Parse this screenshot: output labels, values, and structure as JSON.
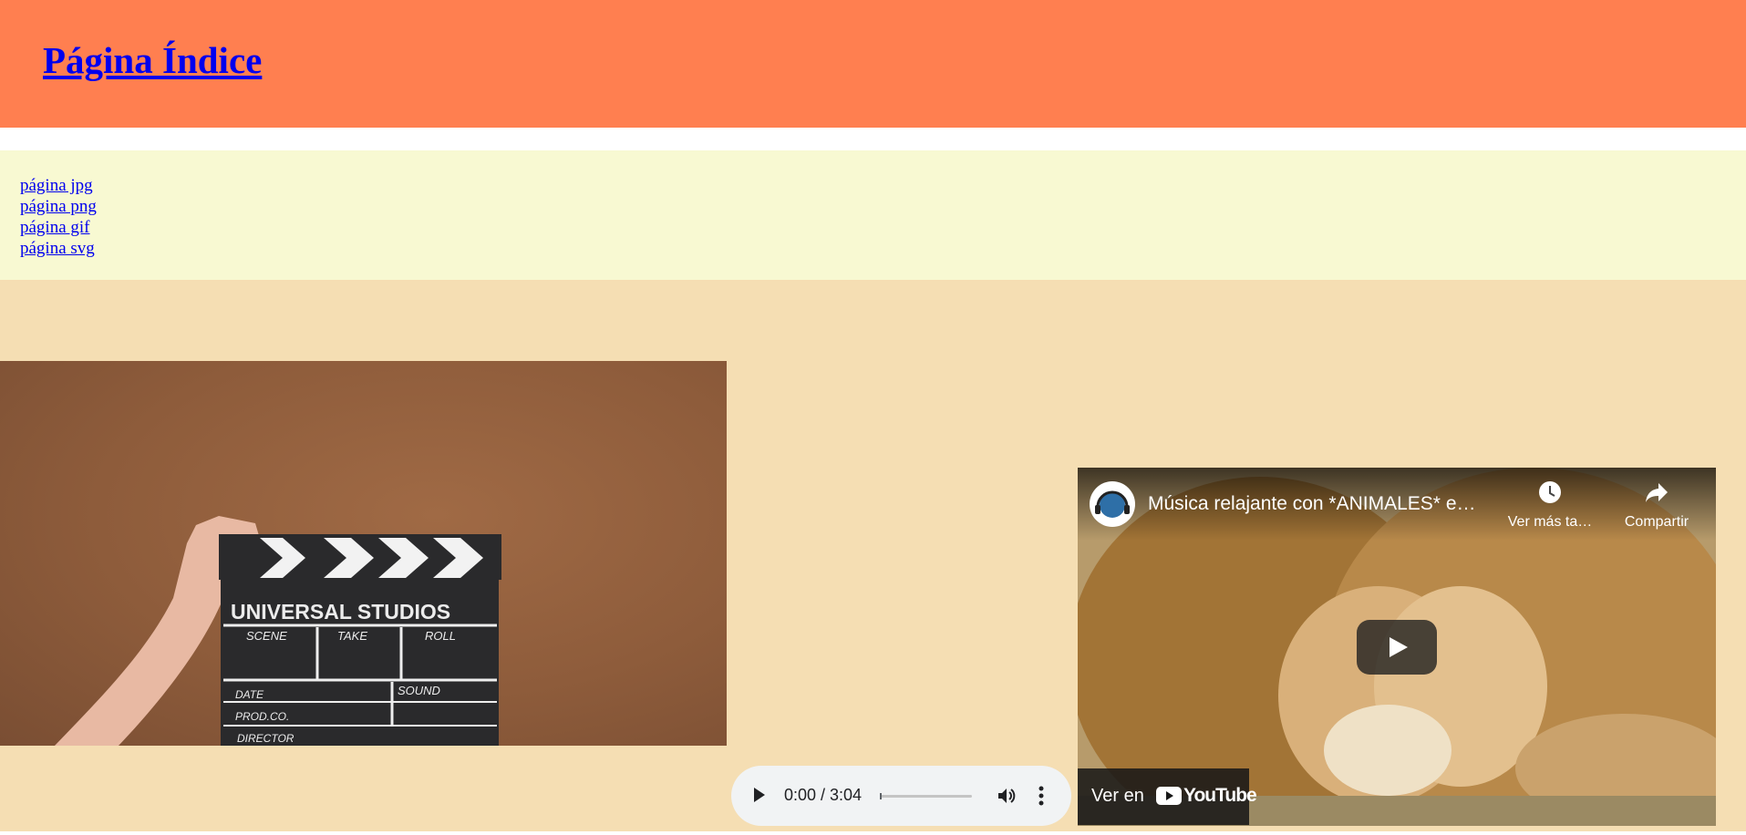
{
  "header": {
    "title": "Página Índice",
    "bg_color": "#ff7f50"
  },
  "nav": {
    "bg_color": "#f8f9d2",
    "links": [
      {
        "label": "página jpg"
      },
      {
        "label": "página png"
      },
      {
        "label": "página gif"
      },
      {
        "label": "página svg"
      }
    ]
  },
  "main": {
    "bg_color": "#f5deb3",
    "video": {
      "icon": "clapperboard-image",
      "clapper_text": "UNIVERSAL STUDIOS",
      "clapper_labels": [
        "SCENE",
        "TAKE",
        "ROLL",
        "DATE",
        "SOUND",
        "PROD.CO.",
        "DIRECTOR"
      ]
    },
    "audio": {
      "time": "0:00 / 3:04",
      "progress": 0
    },
    "youtube": {
      "title": "Música relajante con *ANIMALES* e…",
      "watch_later_label": "Ver más ta…",
      "share_label": "Compartir",
      "watch_on_label": "Ver en",
      "brand": "YouTube"
    }
  }
}
